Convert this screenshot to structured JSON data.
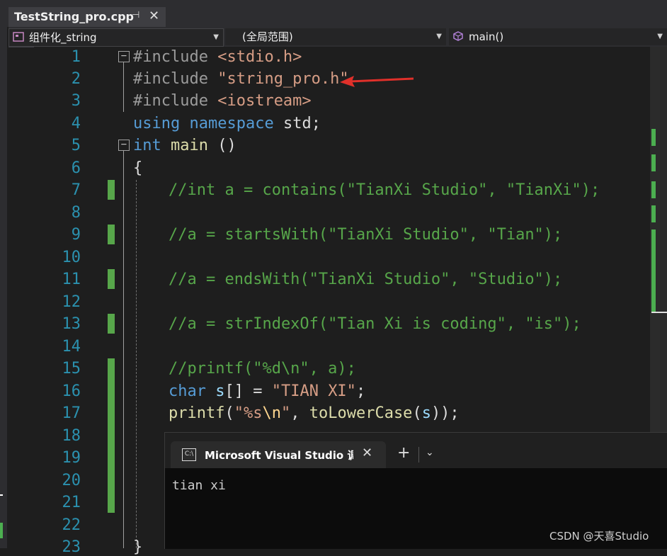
{
  "tab": {
    "title": "TestString_pro.cpp",
    "pin": "⊣",
    "close": "✕"
  },
  "nav": {
    "project": "组件化_string",
    "scope": "(全局范围)",
    "member": "main()"
  },
  "lines": [
    {
      "num": "1"
    },
    {
      "num": "2"
    },
    {
      "num": "3"
    },
    {
      "num": "4"
    },
    {
      "num": "5"
    },
    {
      "num": "6"
    },
    {
      "num": "7"
    },
    {
      "num": "8"
    },
    {
      "num": "9"
    },
    {
      "num": "10"
    },
    {
      "num": "11"
    },
    {
      "num": "12"
    },
    {
      "num": "13"
    },
    {
      "num": "14"
    },
    {
      "num": "15"
    },
    {
      "num": "16"
    },
    {
      "num": "17"
    },
    {
      "num": "18"
    },
    {
      "num": "19"
    },
    {
      "num": "20"
    },
    {
      "num": "21"
    },
    {
      "num": "22"
    },
    {
      "num": "23"
    }
  ],
  "code": {
    "l1_kw": "#include",
    "l1_str": "<stdio.h>",
    "l2_kw": "#include",
    "l2_str": "\"string_pro.h\"",
    "l3_kw": "#include",
    "l3_str": "<iostream>",
    "l4_a": "using",
    "l4_b": "namespace",
    "l4_c": "std;",
    "l5_a": "int",
    "l5_b": "main",
    "l5_c": "()",
    "l6": "{",
    "l7": "//int a = contains(\"TianXi Studio\", \"TianXi\");",
    "l9": "//a = startsWith(\"TianXi Studio\", \"Tian\");",
    "l11": "//a = endsWith(\"TianXi Studio\", \"Studio\");",
    "l13": "//a = strIndexOf(\"Tian Xi is coding\", \"is\");",
    "l15": "//printf(\"%d\\n\", a);",
    "l16_kw": "char",
    "l16_var": "s",
    "l16_op": "[] = ",
    "l16_str": "\"TIAN XI\"",
    "l16_end": ";",
    "l17_fn": "printf",
    "l17_p1": "(",
    "l17_s1": "\"%s",
    "l17_esc": "\\n",
    "l17_s2": "\"",
    "l17_p2": ", ",
    "l17_fn2": "toLowerCase",
    "l17_p3": "(",
    "l17_var": "s",
    "l17_p4": "));",
    "l23": "}"
  },
  "console": {
    "title": "Microsoft Visual Studio 调试控制台",
    "close": "✕",
    "add": "+",
    "dropdown": "⌄",
    "output": "tian xi",
    "icon_text": "C:\\"
  },
  "watermark": "CSDN @天喜Studio",
  "icons": {
    "fold": "minus-box-icon",
    "arrow": "red-arrow-annotation",
    "project": "project-icon",
    "member": "cube-icon"
  },
  "colors": {
    "keyword": "#569cd6",
    "string": "#d69d85",
    "comment": "#57a64a",
    "linenum": "#2b91af",
    "changebar": "#57a64a",
    "arrow": "#e0302a"
  }
}
